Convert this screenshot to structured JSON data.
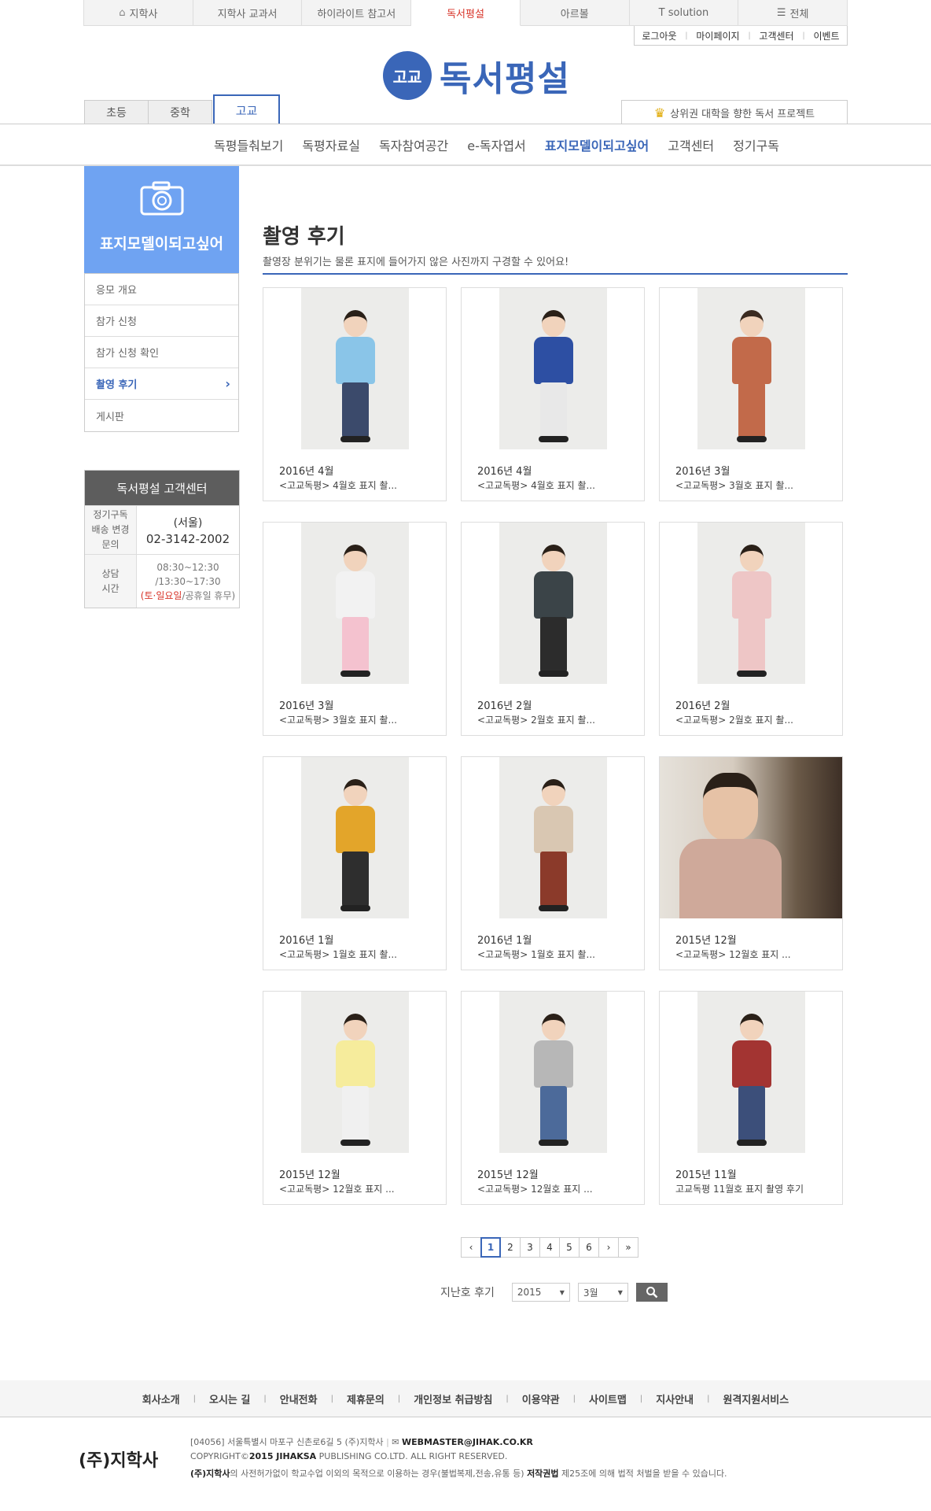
{
  "top_tabs": [
    "지학사",
    "지학사 교과서",
    "하이라이트 참고서",
    "독서평설",
    "아르볼",
    "T solution",
    "전체"
  ],
  "util": [
    "로그아웃",
    "마이페이지",
    "고객센터",
    "이벤트"
  ],
  "logo": {
    "badge": "고교",
    "name": "독서평설"
  },
  "level_tabs": [
    "초등",
    "중학",
    "고교"
  ],
  "project": "상위권 대학을 향한 독서 프로젝트",
  "main_nav": [
    "독평들춰보기",
    "독평자료실",
    "독자참여공간",
    "e-독자엽서",
    "표지모델이되고싶어",
    "고객센터",
    "정기구독"
  ],
  "sidebar": {
    "title": "표지모델이되고싶어",
    "items": [
      "응모 개요",
      "참가 신청",
      "참가 신청 확인",
      "촬영 후기",
      "게시판"
    ]
  },
  "cs": {
    "title": "독서평설 고객센터",
    "label1": "정기구독\n배송 변경\n문의",
    "region": "(서울)",
    "phone": "02-3142-2002",
    "label2": "상담\n시간",
    "hours1": "08:30~12:30",
    "hours2": "/13:30~17:30",
    "holiday_red": "(토·일요일",
    "holiday_rest": "/공휴일 휴무)"
  },
  "content": {
    "title": "촬영 후기",
    "subtitle": "촬영장 분위기는 물론 표지에 들어가지 않은 사진까지 구경할 수 있어요!",
    "cards": [
      {
        "title": "2016년 4월",
        "desc": "<고교독평> 4월호 표지 촬..."
      },
      {
        "title": "2016년 4월",
        "desc": "<고교독평> 4월호 표지 촬..."
      },
      {
        "title": "2016년 3월",
        "desc": "<고교독평> 3월호 표지 촬..."
      },
      {
        "title": "2016년 3월",
        "desc": "<고교독평> 3월호 표지 촬..."
      },
      {
        "title": "2016년 2월",
        "desc": "<고교독평> 2월호 표지 촬..."
      },
      {
        "title": "2016년 2월",
        "desc": "<고교독평> 2월호 표지 촬..."
      },
      {
        "title": "2016년 1월",
        "desc": "<고교독평> 1월호 표지 촬..."
      },
      {
        "title": "2016년 1월",
        "desc": "<고교독평> 1월호 표지 촬..."
      },
      {
        "title": "2015년 12월",
        "desc": "<고교독평> 12월호 표지 ..."
      },
      {
        "title": "2015년 12월",
        "desc": "<고교독평> 12월호 표지 ..."
      },
      {
        "title": "2015년 12월",
        "desc": "<고교독평> 12월호 표지 ..."
      },
      {
        "title": "2015년 11월",
        "desc": "고교독평 11월호 표지 촬영 후기"
      }
    ]
  },
  "pager": {
    "prev": "‹",
    "pages": [
      "1",
      "2",
      "3",
      "4",
      "5",
      "6"
    ],
    "next": "›",
    "last": "»"
  },
  "past": {
    "label": "지난호 후기",
    "year": "2015",
    "month": "3월"
  },
  "footer": {
    "links": [
      "회사소개",
      "오시는 길",
      "안내전화",
      "제휴문의",
      "개인정보 취급방침",
      "이용약관",
      "사이트맵",
      "지사안내",
      "원격지원서비스"
    ],
    "logo": "(주)지학사",
    "address": "[04056] 서울특별시 마포구 신촌로6길 5 (주)지학사",
    "email": "WEBMASTER@JIHAK.CO.KR",
    "copyright_pre": "COPYRIGHT©",
    "copyright_year": "2015 JIHAKSA",
    "copyright_post": " PUBLISHING CO.LTD. ALL RIGHT RESERVED.",
    "notice_a": "(주)지학사",
    "notice_b": "의 사전허가없이 학교수업 이외의 목적으로 이용하는 경우(불법복제,전송,유통 등) ",
    "notice_c": "저작권법",
    "notice_d": " 제25조에 의해 법적 처벌을 받을 수 있습니다."
  }
}
